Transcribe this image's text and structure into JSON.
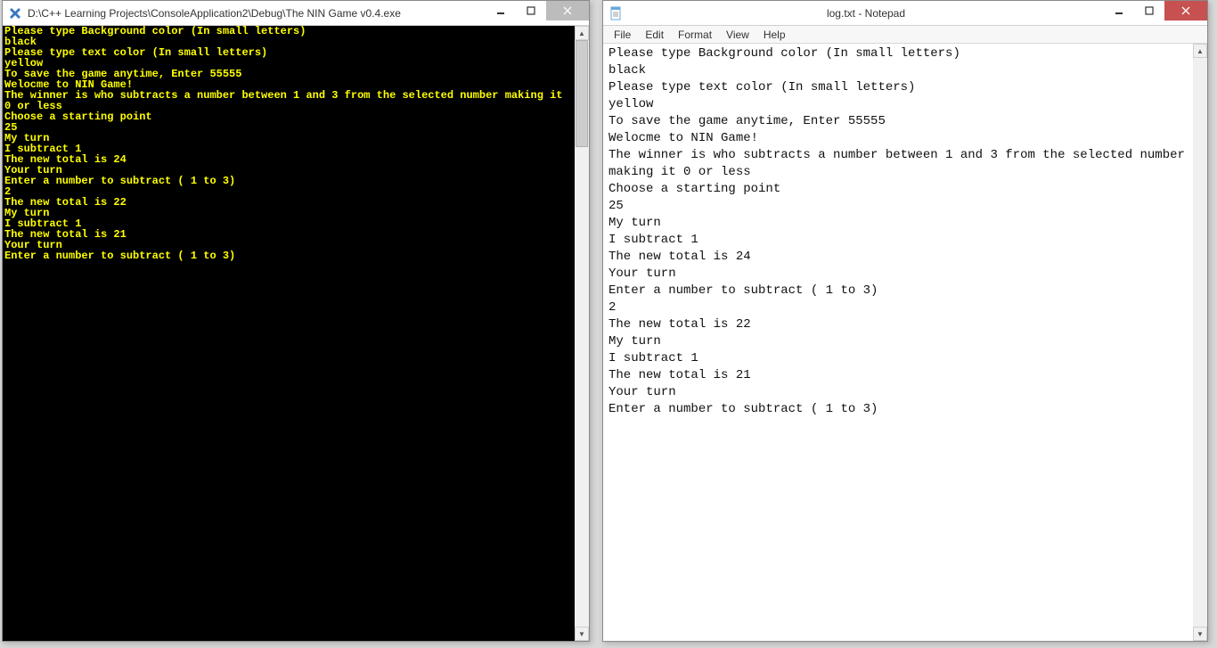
{
  "console": {
    "title": "D:\\C++ Learning Projects\\ConsoleApplication2\\Debug\\The NIN Game v0.4.exe",
    "text_color": "#ffff00",
    "bg_color": "#000000",
    "lines": [
      "Please type Background color (In small letters)",
      "black",
      "Please type text color (In small letters)",
      "yellow",
      "To save the game anytime, Enter 55555",
      "Welocme to NIN Game!",
      "The winner is who subtracts a number between 1 and 3 from the selected number making it 0 or less",
      "Choose a starting point",
      "25",
      "My turn",
      "I subtract 1",
      "The new total is 24",
      "Your turn",
      "Enter a number to subtract ( 1 to 3)",
      "2",
      "The new total is 22",
      "My turn",
      "I subtract 1",
      "The new total is 21",
      "Your turn",
      "Enter a number to subtract ( 1 to 3)"
    ]
  },
  "notepad": {
    "title": "log.txt - Notepad",
    "menu": {
      "file": "File",
      "edit": "Edit",
      "format": "Format",
      "view": "View",
      "help": "Help"
    },
    "lines": [
      "Please type Background color (In small letters)",
      "black",
      "Please type text color (In small letters)",
      "yellow",
      "To save the game anytime, Enter 55555",
      "Welocme to NIN Game!",
      "The winner is who subtracts a number between 1 and 3 from the selected number making it 0 or less",
      "Choose a starting point",
      "25",
      "My turn",
      "I subtract 1",
      "The new total is 24",
      "Your turn",
      "Enter a number to subtract ( 1 to 3)",
      "2",
      "The new total is 22",
      "My turn",
      "I subtract 1",
      "The new total is 21",
      "Your turn",
      "Enter a number to subtract ( 1 to 3)"
    ]
  }
}
